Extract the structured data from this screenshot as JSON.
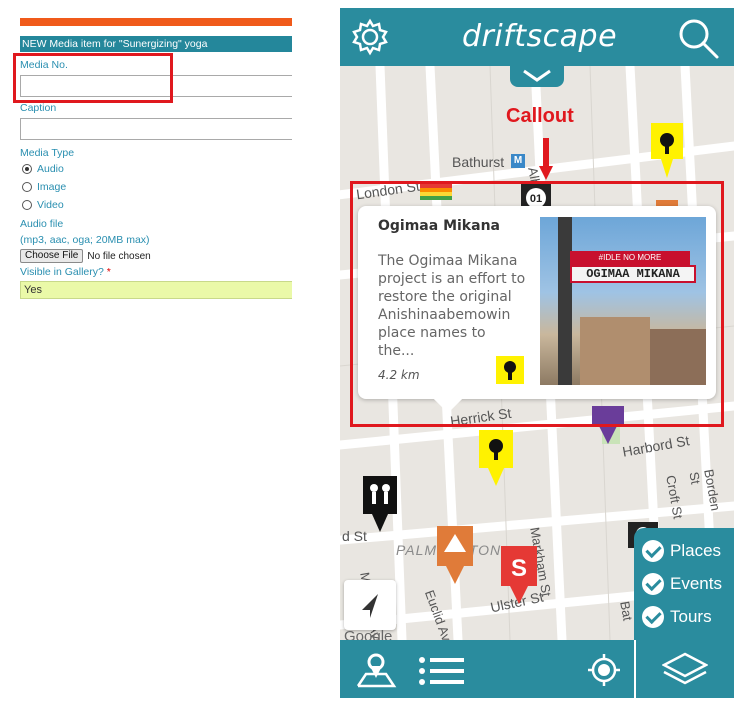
{
  "form": {
    "header": "NEW Media item for \"Sunergizing\" yoga",
    "media_no_label": "Media No.",
    "media_no_value": "",
    "caption_label": "Caption",
    "caption_value": "",
    "media_type_label": "Media Type",
    "media_types": [
      {
        "label": "Audio",
        "selected": true
      },
      {
        "label": "Image",
        "selected": false
      },
      {
        "label": "Video",
        "selected": false
      }
    ],
    "audio_file_label": "Audio file",
    "audio_file_hint": "(mp3, aac, oga; 20MB max)",
    "choose_file_button": "Choose File",
    "no_file_text": "No file chosen",
    "visible_label": "Visible in Gallery?",
    "required_mark": "*",
    "visible_value": "Yes"
  },
  "app": {
    "brand": "driftscape",
    "callout_label": "Callout",
    "marker_number": "01",
    "streets": {
      "bathurst": "Bathurst",
      "london": "London St",
      "albany": "Albany Ave",
      "herrick": "Herrick St",
      "harbord": "Harbord St",
      "croft": "Croft St",
      "borden": "Borden St",
      "palmerston": "PALMERSTON",
      "markham": "Markham St",
      "euclid": "Euclid Ave",
      "ulster": "Ulster St",
      "manning": "Manning Ave",
      "bathurst_vertical": "Bat",
      "st_left": "d St"
    },
    "card": {
      "title": "Ogimaa Mikana",
      "description": "The Ogimaa Mikana project is an effort to restore the original Anishinaabemowin place names to the...",
      "distance": "4.2 km",
      "photo_sign_top": "#IDLE NO MORE",
      "photo_sign_main": "OGIMAA MIKANA"
    },
    "filters": [
      {
        "label": "Places",
        "checked": true
      },
      {
        "label": "Events",
        "checked": true
      },
      {
        "label": "Tours",
        "checked": true
      }
    ],
    "map_attribution": "Google",
    "colors": {
      "teal": "#2a8c9e",
      "callout_red": "#e0181e",
      "marker_yellow": "#fff200",
      "marker_orange": "#e07b39",
      "marker_red": "#e53935",
      "marker_purple": "#6a3d9a"
    }
  }
}
